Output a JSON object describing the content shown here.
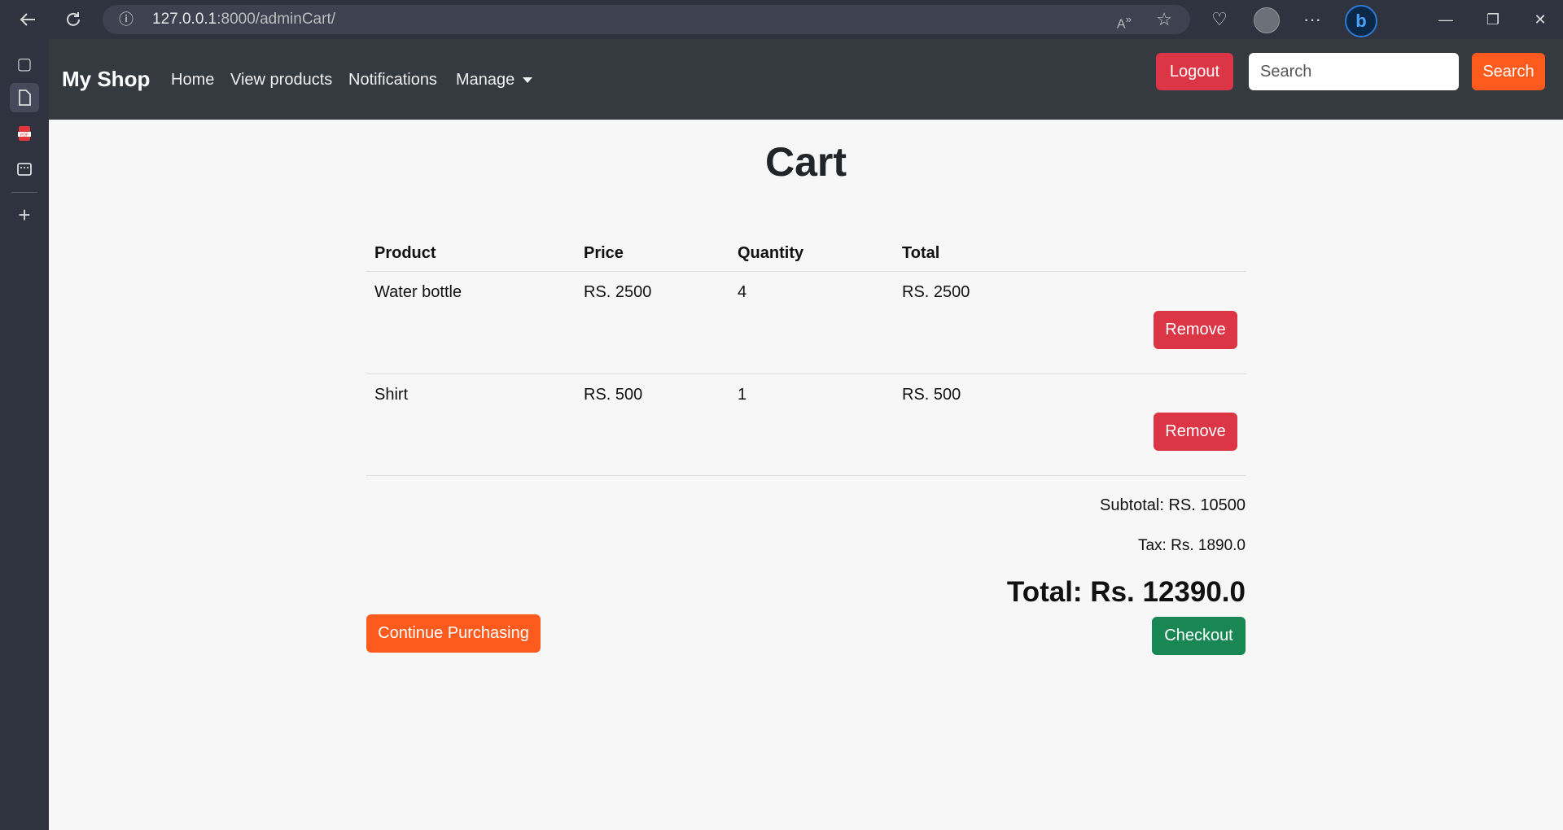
{
  "browser": {
    "url_host": "127.0.0.1",
    "url_rest": ":8000/adminCart/",
    "more_glyph": "···"
  },
  "navbar": {
    "brand": "My Shop",
    "links": [
      "Home",
      "View products",
      "Notifications",
      "Manage"
    ],
    "logout_label": "Logout",
    "search_placeholder": "Search",
    "search_button_label": "Search"
  },
  "cart": {
    "title": "Cart",
    "columns": [
      "Product",
      "Price",
      "Quantity",
      "Total"
    ],
    "rows": [
      {
        "product": "Water bottle",
        "price": "RS. 2500",
        "quantity": "4",
        "total": "RS. 2500",
        "action": "Remove"
      },
      {
        "product": "Shirt",
        "price": "RS. 500",
        "quantity": "1",
        "total": "RS. 500",
        "action": "Remove"
      }
    ],
    "subtotal": "Subtotal: RS. 10500",
    "tax": "Tax: Rs. 1890.0",
    "grand_total": "Total: Rs. 12390.0",
    "continue_label": "Continue Purchasing",
    "checkout_label": "Checkout"
  },
  "colors": {
    "navbar_bg": "#343a40",
    "danger": "#dc3545",
    "accent_orange": "#fd5a1e",
    "success": "#198754"
  }
}
